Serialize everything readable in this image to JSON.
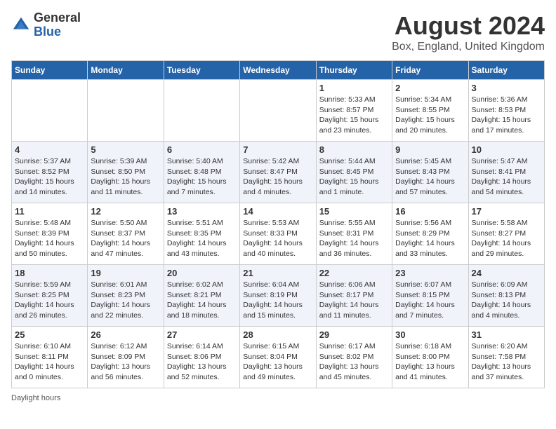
{
  "header": {
    "logo_general": "General",
    "logo_blue": "Blue",
    "month_title": "August 2024",
    "location": "Box, England, United Kingdom"
  },
  "days_of_week": [
    "Sunday",
    "Monday",
    "Tuesday",
    "Wednesday",
    "Thursday",
    "Friday",
    "Saturday"
  ],
  "footer": "Daylight hours",
  "weeks": [
    [
      {
        "day": "",
        "info": ""
      },
      {
        "day": "",
        "info": ""
      },
      {
        "day": "",
        "info": ""
      },
      {
        "day": "",
        "info": ""
      },
      {
        "day": "1",
        "info": "Sunrise: 5:33 AM\nSunset: 8:57 PM\nDaylight: 15 hours\nand 23 minutes."
      },
      {
        "day": "2",
        "info": "Sunrise: 5:34 AM\nSunset: 8:55 PM\nDaylight: 15 hours\nand 20 minutes."
      },
      {
        "day": "3",
        "info": "Sunrise: 5:36 AM\nSunset: 8:53 PM\nDaylight: 15 hours\nand 17 minutes."
      }
    ],
    [
      {
        "day": "4",
        "info": "Sunrise: 5:37 AM\nSunset: 8:52 PM\nDaylight: 15 hours\nand 14 minutes."
      },
      {
        "day": "5",
        "info": "Sunrise: 5:39 AM\nSunset: 8:50 PM\nDaylight: 15 hours\nand 11 minutes."
      },
      {
        "day": "6",
        "info": "Sunrise: 5:40 AM\nSunset: 8:48 PM\nDaylight: 15 hours\nand 7 minutes."
      },
      {
        "day": "7",
        "info": "Sunrise: 5:42 AM\nSunset: 8:47 PM\nDaylight: 15 hours\nand 4 minutes."
      },
      {
        "day": "8",
        "info": "Sunrise: 5:44 AM\nSunset: 8:45 PM\nDaylight: 15 hours\nand 1 minute."
      },
      {
        "day": "9",
        "info": "Sunrise: 5:45 AM\nSunset: 8:43 PM\nDaylight: 14 hours\nand 57 minutes."
      },
      {
        "day": "10",
        "info": "Sunrise: 5:47 AM\nSunset: 8:41 PM\nDaylight: 14 hours\nand 54 minutes."
      }
    ],
    [
      {
        "day": "11",
        "info": "Sunrise: 5:48 AM\nSunset: 8:39 PM\nDaylight: 14 hours\nand 50 minutes."
      },
      {
        "day": "12",
        "info": "Sunrise: 5:50 AM\nSunset: 8:37 PM\nDaylight: 14 hours\nand 47 minutes."
      },
      {
        "day": "13",
        "info": "Sunrise: 5:51 AM\nSunset: 8:35 PM\nDaylight: 14 hours\nand 43 minutes."
      },
      {
        "day": "14",
        "info": "Sunrise: 5:53 AM\nSunset: 8:33 PM\nDaylight: 14 hours\nand 40 minutes."
      },
      {
        "day": "15",
        "info": "Sunrise: 5:55 AM\nSunset: 8:31 PM\nDaylight: 14 hours\nand 36 minutes."
      },
      {
        "day": "16",
        "info": "Sunrise: 5:56 AM\nSunset: 8:29 PM\nDaylight: 14 hours\nand 33 minutes."
      },
      {
        "day": "17",
        "info": "Sunrise: 5:58 AM\nSunset: 8:27 PM\nDaylight: 14 hours\nand 29 minutes."
      }
    ],
    [
      {
        "day": "18",
        "info": "Sunrise: 5:59 AM\nSunset: 8:25 PM\nDaylight: 14 hours\nand 26 minutes."
      },
      {
        "day": "19",
        "info": "Sunrise: 6:01 AM\nSunset: 8:23 PM\nDaylight: 14 hours\nand 22 minutes."
      },
      {
        "day": "20",
        "info": "Sunrise: 6:02 AM\nSunset: 8:21 PM\nDaylight: 14 hours\nand 18 minutes."
      },
      {
        "day": "21",
        "info": "Sunrise: 6:04 AM\nSunset: 8:19 PM\nDaylight: 14 hours\nand 15 minutes."
      },
      {
        "day": "22",
        "info": "Sunrise: 6:06 AM\nSunset: 8:17 PM\nDaylight: 14 hours\nand 11 minutes."
      },
      {
        "day": "23",
        "info": "Sunrise: 6:07 AM\nSunset: 8:15 PM\nDaylight: 14 hours\nand 7 minutes."
      },
      {
        "day": "24",
        "info": "Sunrise: 6:09 AM\nSunset: 8:13 PM\nDaylight: 14 hours\nand 4 minutes."
      }
    ],
    [
      {
        "day": "25",
        "info": "Sunrise: 6:10 AM\nSunset: 8:11 PM\nDaylight: 14 hours\nand 0 minutes."
      },
      {
        "day": "26",
        "info": "Sunrise: 6:12 AM\nSunset: 8:09 PM\nDaylight: 13 hours\nand 56 minutes."
      },
      {
        "day": "27",
        "info": "Sunrise: 6:14 AM\nSunset: 8:06 PM\nDaylight: 13 hours\nand 52 minutes."
      },
      {
        "day": "28",
        "info": "Sunrise: 6:15 AM\nSunset: 8:04 PM\nDaylight: 13 hours\nand 49 minutes."
      },
      {
        "day": "29",
        "info": "Sunrise: 6:17 AM\nSunset: 8:02 PM\nDaylight: 13 hours\nand 45 minutes."
      },
      {
        "day": "30",
        "info": "Sunrise: 6:18 AM\nSunset: 8:00 PM\nDaylight: 13 hours\nand 41 minutes."
      },
      {
        "day": "31",
        "info": "Sunrise: 6:20 AM\nSunset: 7:58 PM\nDaylight: 13 hours\nand 37 minutes."
      }
    ]
  ]
}
